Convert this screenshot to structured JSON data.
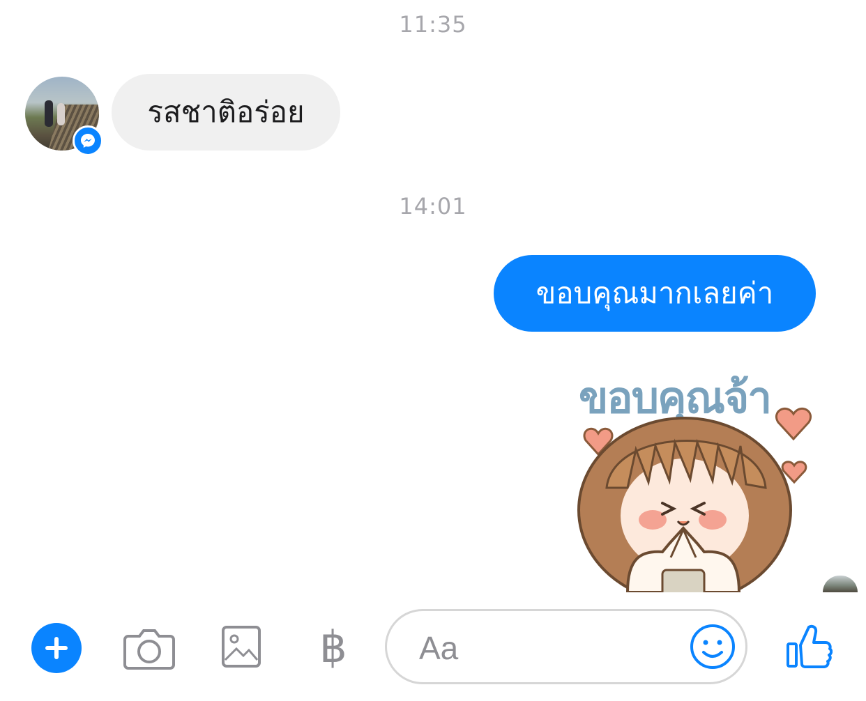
{
  "timestamps": [
    "11:35",
    "14:01"
  ],
  "messages": {
    "incoming_text": "รสชาติอร่อย",
    "outgoing_text": "ขอบคุณมากเลยค่า",
    "sticker_text": "ขอบคุณจ้า"
  },
  "composer": {
    "placeholder": "Aa",
    "baht_symbol": "฿"
  },
  "icons": {
    "add": "plus-icon",
    "camera": "camera-icon",
    "gallery": "image-icon",
    "payment": "baht-icon",
    "emoji": "smiley-icon",
    "like": "thumbs-up-icon",
    "messenger_badge": "messenger-icon"
  },
  "colors": {
    "accent": "#0a84ff",
    "incoming_bubble": "#f0f0f0",
    "timestamp": "#a6a6ab",
    "icon_gray": "#8e8e93"
  }
}
